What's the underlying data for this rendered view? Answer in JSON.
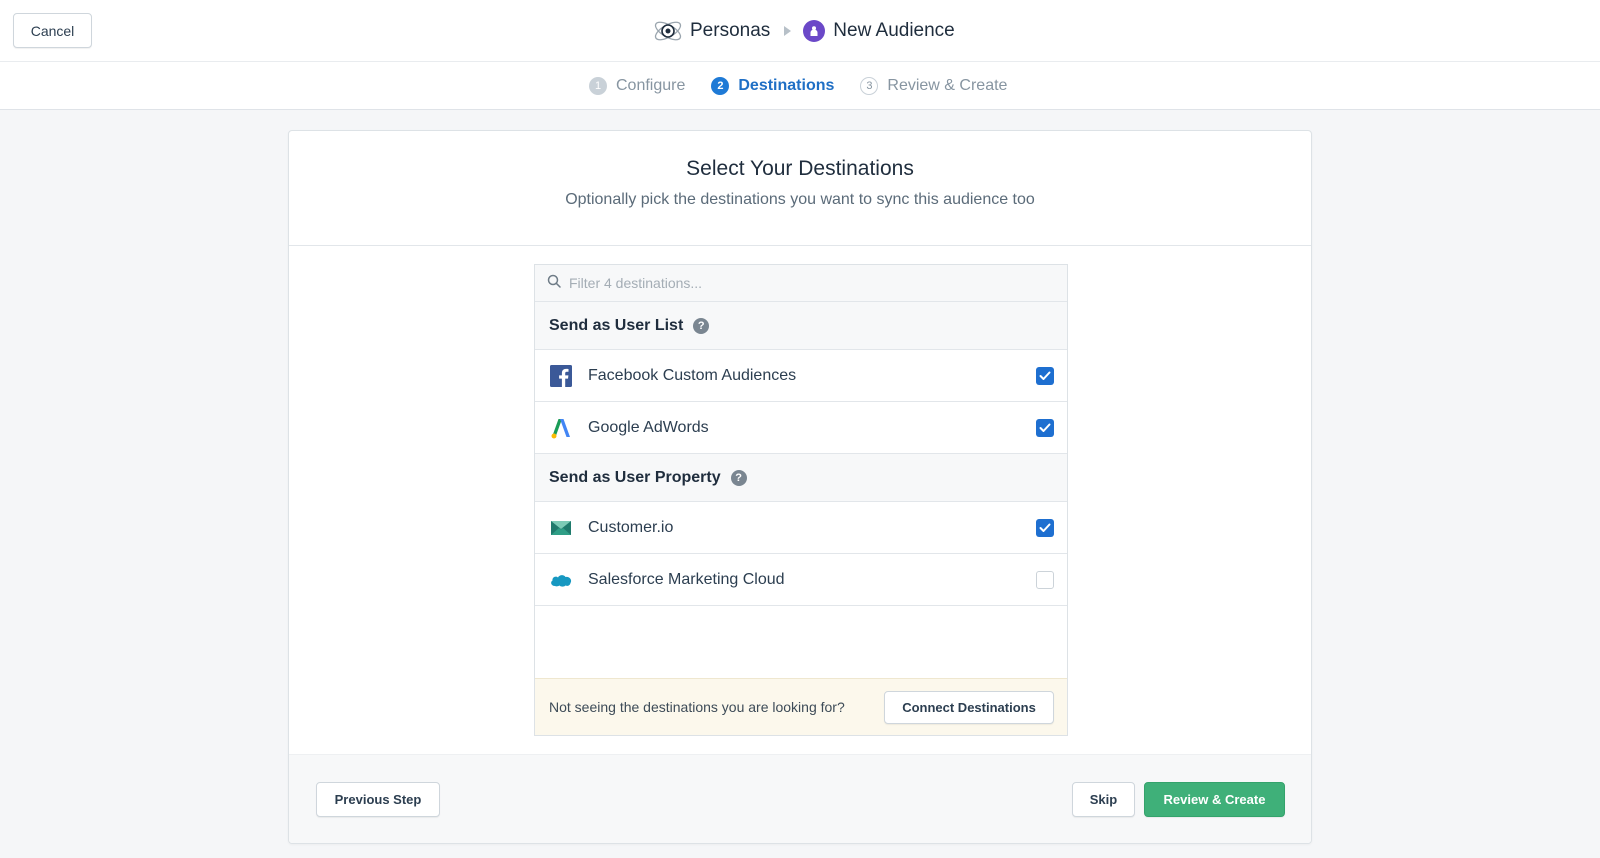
{
  "header": {
    "cancel_label": "Cancel",
    "app_name": "Personas",
    "page_name": "New Audience"
  },
  "steps": [
    {
      "num": "1",
      "label": "Configure",
      "state": "done"
    },
    {
      "num": "2",
      "label": "Destinations",
      "state": "active"
    },
    {
      "num": "3",
      "label": "Review & Create",
      "state": "todo"
    }
  ],
  "main": {
    "title": "Select Your Destinations",
    "subtitle": "Optionally pick the destinations you want to sync this audience too",
    "filter_placeholder": "Filter 4 destinations..."
  },
  "groups": [
    {
      "title": "Send as User List",
      "items": [
        {
          "name": "Facebook Custom Audiences",
          "icon": "facebook-icon",
          "checked": true
        },
        {
          "name": "Google AdWords",
          "icon": "google-adwords-icon",
          "checked": true
        }
      ]
    },
    {
      "title": "Send as User Property",
      "items": [
        {
          "name": "Customer.io",
          "icon": "customerio-icon",
          "checked": true
        },
        {
          "name": "Salesforce Marketing Cloud",
          "icon": "salesforce-icon",
          "checked": false
        }
      ]
    }
  ],
  "notice": {
    "text": "Not seeing the destinations you are looking for?",
    "button_label": "Connect Destinations"
  },
  "footer": {
    "previous_label": "Previous Step",
    "skip_label": "Skip",
    "create_label": "Review & Create"
  },
  "colors": {
    "accent": "#1e6fd0",
    "primary_button": "#3fb079",
    "audience_icon": "#6b48c8"
  }
}
